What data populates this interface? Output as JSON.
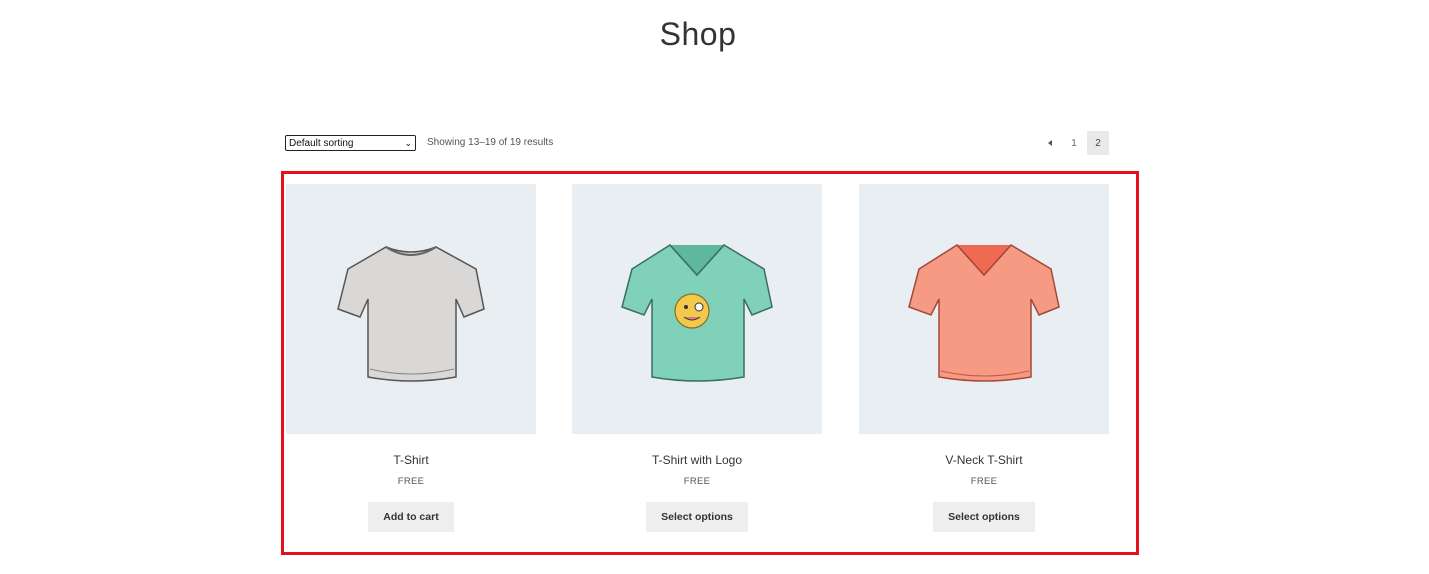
{
  "page": {
    "title": "Shop"
  },
  "toolbar": {
    "sort_selected": "Default sorting",
    "result_count": "Showing 13–19 of 19 results"
  },
  "pagination": {
    "prev_icon": "triangle-left-icon",
    "pages": [
      "1",
      "2"
    ],
    "current": "2"
  },
  "colors": {
    "highlight": "#e4131b",
    "thumb_bg": "#e8eef2",
    "button_bg": "#eeeeee"
  },
  "products": [
    {
      "name": "T-Shirt",
      "price": "FREE",
      "button": "Add to cart",
      "image": "tshirt-grey-illustration"
    },
    {
      "name": "T-Shirt with Logo",
      "price": "FREE",
      "button": "Select options",
      "image": "tshirt-green-logo-illustration"
    },
    {
      "name": "V-Neck T-Shirt",
      "price": "FREE",
      "button": "Select options",
      "image": "vneck-tshirt-coral-illustration"
    }
  ]
}
